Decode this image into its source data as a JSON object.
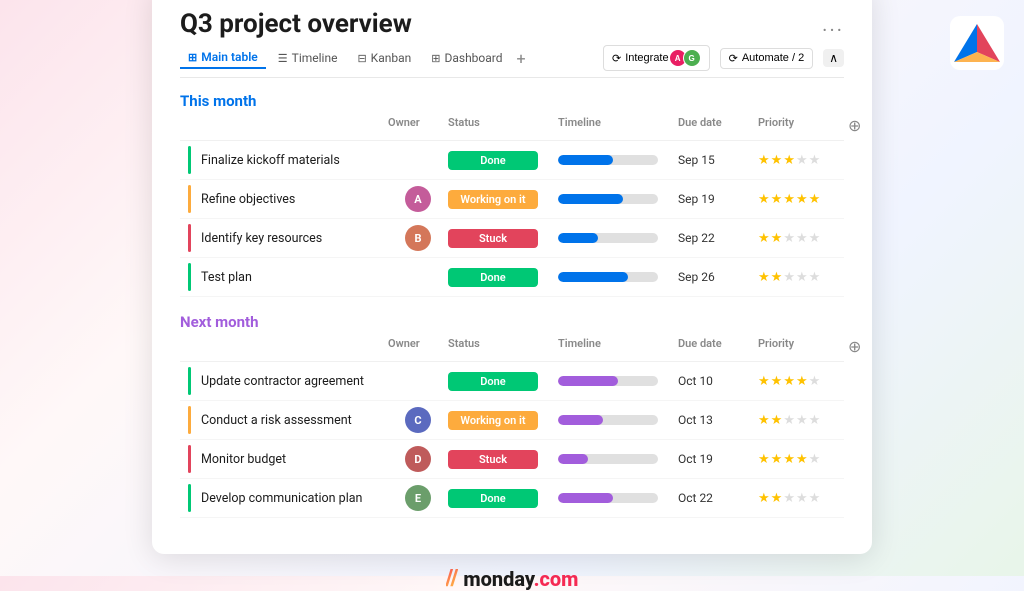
{
  "page": {
    "title": "Q3 project overview",
    "dots_label": "...",
    "background_colors": {
      "primary": "#fce4ec",
      "secondary": "#f0f4ff"
    }
  },
  "tabs": [
    {
      "id": "main-table",
      "label": "Main table",
      "icon": "⊞",
      "active": true
    },
    {
      "id": "timeline",
      "label": "Timeline",
      "icon": "≡",
      "active": false
    },
    {
      "id": "kanban",
      "label": "Kanban",
      "icon": "⊟",
      "active": false
    },
    {
      "id": "dashboard",
      "label": "Dashboard",
      "icon": "⊞",
      "active": false
    }
  ],
  "tab_plus": "+",
  "toolbar": {
    "integrate_label": "Integrate",
    "automate_label": "Automate / 2",
    "collapse_label": "∧"
  },
  "sections": [
    {
      "id": "this-month",
      "title": "This month",
      "color_class": "blue",
      "columns": [
        "",
        "Owner",
        "Status",
        "Timeline",
        "Due date",
        "Priority",
        ""
      ],
      "rows": [
        {
          "id": "row-1",
          "task": "Finalize kickoff materials",
          "border_color": "#00c875",
          "owner": null,
          "owner_initials": "",
          "owner_color": "",
          "status": "Done",
          "status_class": "status-done",
          "timeline_width": 55,
          "timeline_class": "timeline-blue",
          "due_date": "Sep 15",
          "stars_filled": 3,
          "stars_empty": 2
        },
        {
          "id": "row-2",
          "task": "Refine objectives",
          "border_color": "#fdab3d",
          "owner": true,
          "owner_initials": "A",
          "owner_color": "#c45c9a",
          "status": "Working on it",
          "status_class": "status-working",
          "timeline_width": 65,
          "timeline_class": "timeline-blue",
          "due_date": "Sep 19",
          "stars_filled": 5,
          "stars_empty": 0
        },
        {
          "id": "row-3",
          "task": "Identify key resources",
          "border_color": "#e2445c",
          "owner": true,
          "owner_initials": "B",
          "owner_color": "#d4775a",
          "status": "Stuck",
          "status_class": "status-stuck",
          "timeline_width": 40,
          "timeline_class": "timeline-blue",
          "due_date": "Sep 22",
          "stars_filled": 2,
          "stars_empty": 3
        },
        {
          "id": "row-4",
          "task": "Test plan",
          "border_color": "#00c875",
          "owner": null,
          "owner_initials": "",
          "owner_color": "",
          "status": "Done",
          "status_class": "status-done",
          "timeline_width": 70,
          "timeline_class": "timeline-blue",
          "due_date": "Sep 26",
          "stars_filled": 2,
          "stars_empty": 3
        }
      ]
    },
    {
      "id": "next-month",
      "title": "Next month",
      "color_class": "purple",
      "columns": [
        "",
        "Owner",
        "Status",
        "Timeline",
        "Due date",
        "Priority",
        ""
      ],
      "rows": [
        {
          "id": "row-5",
          "task": "Update contractor agreement",
          "border_color": "#00c875",
          "owner": null,
          "owner_initials": "",
          "owner_color": "",
          "status": "Done",
          "status_class": "status-done",
          "timeline_width": 60,
          "timeline_class": "timeline-purple",
          "due_date": "Oct 10",
          "stars_filled": 4,
          "stars_empty": 1
        },
        {
          "id": "row-6",
          "task": "Conduct a risk assessment",
          "border_color": "#fdab3d",
          "owner": true,
          "owner_initials": "C",
          "owner_color": "#5b6abf",
          "status": "Working on it",
          "status_class": "status-working",
          "timeline_width": 45,
          "timeline_class": "timeline-purple",
          "due_date": "Oct 13",
          "stars_filled": 2,
          "stars_empty": 3
        },
        {
          "id": "row-7",
          "task": "Monitor budget",
          "border_color": "#e2445c",
          "owner": true,
          "owner_initials": "D",
          "owner_color": "#bf5b5b",
          "status": "Stuck",
          "status_class": "status-stuck",
          "timeline_width": 30,
          "timeline_class": "timeline-purple",
          "due_date": "Oct 19",
          "stars_filled": 4,
          "stars_empty": 1
        },
        {
          "id": "row-8",
          "task": "Develop communication plan",
          "border_color": "#00c875",
          "owner": true,
          "owner_initials": "E",
          "owner_color": "#6b9e6b",
          "status": "Done",
          "status_class": "status-done",
          "timeline_width": 55,
          "timeline_class": "timeline-purple",
          "due_date": "Oct 22",
          "stars_filled": 2,
          "stars_empty": 3
        }
      ]
    }
  ],
  "logo": {
    "icon": "//",
    "name": "monday",
    "tld": ".com"
  }
}
